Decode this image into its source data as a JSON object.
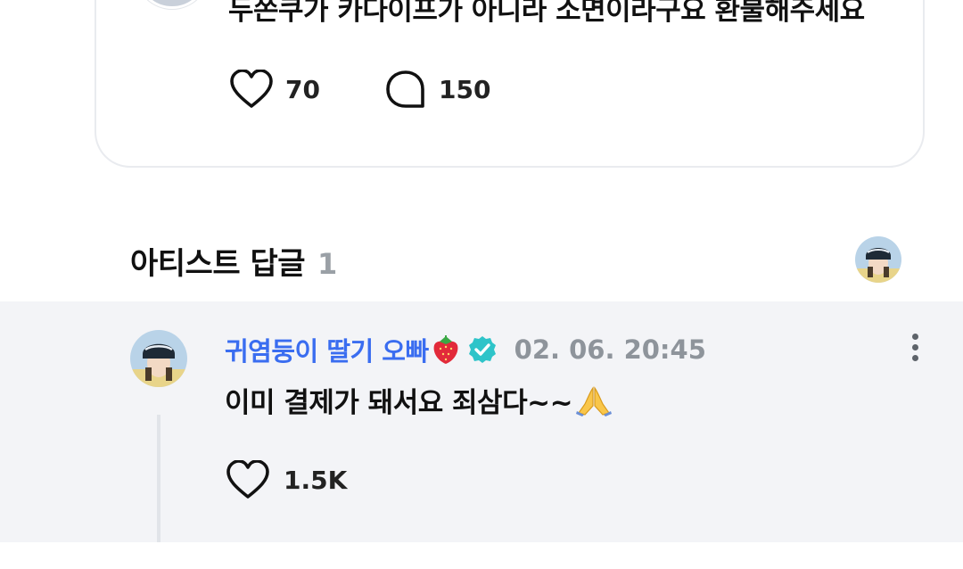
{
  "post": {
    "text": "두쫀쿠가 카다이프가 아니라 소면이라구요 환불해주세요",
    "like_count": "70",
    "comment_count": "150",
    "icons": {
      "like": "heart-icon",
      "comment": "comment-bubble-icon"
    }
  },
  "section": {
    "title": "아티스트 답글",
    "count": "1"
  },
  "reply": {
    "author": "귀염둥이 딸기 오빠",
    "timestamp": "02. 06. 20:45",
    "text": "이미 결제가 돼서요 죄삼다~~",
    "like_count": "1.5K",
    "icons": {
      "author_emoji": "strawberry-icon",
      "verified": "verified-badge-icon",
      "text_emoji": "folded-hands-icon",
      "menu": "more-vertical-icon",
      "like": "heart-icon"
    }
  },
  "colors": {
    "author_name": "#3a6df0",
    "verified_badge": "#2ec4c9",
    "muted": "#8e949b",
    "reply_background": "#f3f4f7"
  }
}
